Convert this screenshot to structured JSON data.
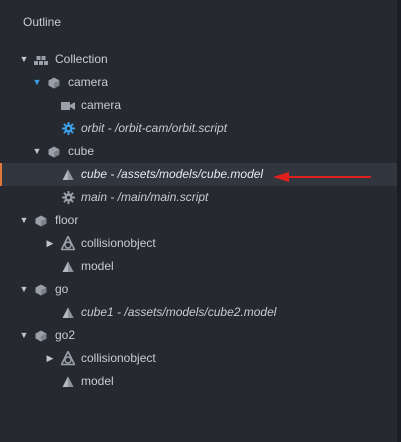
{
  "panel": {
    "title": "Outline"
  },
  "colors": {
    "background": "#262a30",
    "selected_row": "#32363e",
    "selection_accent": "#e07a3a",
    "expand_arrow_blue": "#3ea0e6",
    "annotation_arrow": "#e0201c"
  },
  "tree": [
    {
      "label": "Collection",
      "icon": "collection-icon",
      "expand": "expanded"
    },
    {
      "label": "camera",
      "icon": "game-object-icon",
      "expand": "expanded"
    },
    {
      "label": "camera",
      "icon": "camera-icon"
    },
    {
      "label": "orbit - /orbit-cam/orbit.script",
      "icon": "script-gear-icon"
    },
    {
      "label": "cube",
      "icon": "game-object-icon",
      "expand": "expanded"
    },
    {
      "label": "cube - /assets/models/cube.model",
      "icon": "model-icon",
      "selected": true
    },
    {
      "label": "main - /main/main.script",
      "icon": "script-gear-icon"
    },
    {
      "label": "floor",
      "icon": "game-object-icon",
      "expand": "expanded"
    },
    {
      "label": "collisionobject",
      "icon": "collision-object-icon",
      "expand": "collapsed"
    },
    {
      "label": "model",
      "icon": "model-icon"
    },
    {
      "label": "go",
      "icon": "game-object-icon",
      "expand": "expanded"
    },
    {
      "label": "cube1 - /assets/models/cube2.model",
      "icon": "model-icon"
    },
    {
      "label": "go2",
      "icon": "game-object-icon",
      "expand": "expanded"
    },
    {
      "label": "collisionobject",
      "icon": "collision-object-icon",
      "expand": "collapsed"
    },
    {
      "label": "model",
      "icon": "model-icon"
    }
  ]
}
